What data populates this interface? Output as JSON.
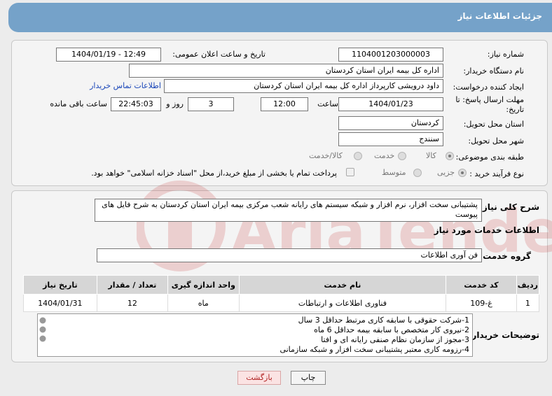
{
  "header": {
    "title": "جزئیات اطلاعات نیاز"
  },
  "form": {
    "need_number_label": "شماره نیاز:",
    "need_number": "1104001203000003",
    "announce_label": "تاریخ و ساعت اعلان عمومی:",
    "announce_value": "1404/01/19 - 12:49",
    "buyer_org_label": "نام دستگاه خریدار:",
    "buyer_org": "اداره کل بیمه ایران استان کردستان",
    "requester_label": "ایجاد کننده درخواست:",
    "requester": "داود درویشی کارپرداز اداره کل بیمه ایران استان کردستان",
    "contact_link": "اطلاعات تماس خریدار",
    "deadline_label_1": "مهلت ارسال پاسخ: تا",
    "deadline_label_2": "تاریخ:",
    "deadline_date": "1404/01/23",
    "time_label": "ساعت",
    "deadline_time": "12:00",
    "days_value": "3",
    "days_label": "روز و",
    "remaining_time": "22:45:03",
    "remaining_label": "ساعت باقی مانده",
    "province_label": "استان محل تحویل:",
    "province": "کردستان",
    "city_label": "شهر محل تحویل:",
    "city": "سنندج",
    "category_label": "طبقه بندی موضوعی:",
    "category_goods": "کالا",
    "category_service": "خدمت",
    "category_both": "کالا/خدمت",
    "process_label": "نوع فرآیند خرید :",
    "process_partial": "جزیی",
    "process_medium": "متوسط",
    "payment_note": "پرداخت تمام یا بخشی از مبلغ خرید،از محل \"اسناد خزانه اسلامی\" خواهد بود."
  },
  "description": {
    "label": "شرح کلی نیاز:",
    "text": "پشتیبانی سخت افزار، نرم افزار و شبکه سیستم های رایانه شعب مرکزی بیمه ایران استان کردستان به شرح فایل های پیوست"
  },
  "services": {
    "section_title": "اطلاعات خدمات مورد نیاز",
    "group_label": "گروه خدمت:",
    "group_value": "فن آوری اطلاعات",
    "columns": {
      "row": "ردیف",
      "code": "کد خدمت",
      "name": "نام خدمت",
      "unit": "واحد اندازه گیری",
      "qty": "تعداد / مقدار",
      "date": "تاریخ نیاز"
    },
    "rows": [
      {
        "row": "1",
        "code": "غ-109",
        "name": "فناوری اطلاعات و ارتباطات",
        "unit": "ماه",
        "qty": "12",
        "date": "1404/01/31"
      }
    ]
  },
  "buyer_notes": {
    "label": "توضیحات خریدار:",
    "lines": [
      "1-شرکت حقوقی با سابقه کاری مرتبط حداقل 3 سال",
      "2-نیروی کار متخصص با سابقه بیمه حداقل 6 ماه",
      "3-مجوز از سازمان نظام صنفی رایانه ای و افتا",
      "4-رزومه کاری معتبر پشتیبانی سخت افزار و شبکه سازمانی"
    ]
  },
  "actions": {
    "print": "چاپ",
    "back": "بازگشت"
  },
  "watermark": {
    "text": "AriaTender.neT"
  }
}
